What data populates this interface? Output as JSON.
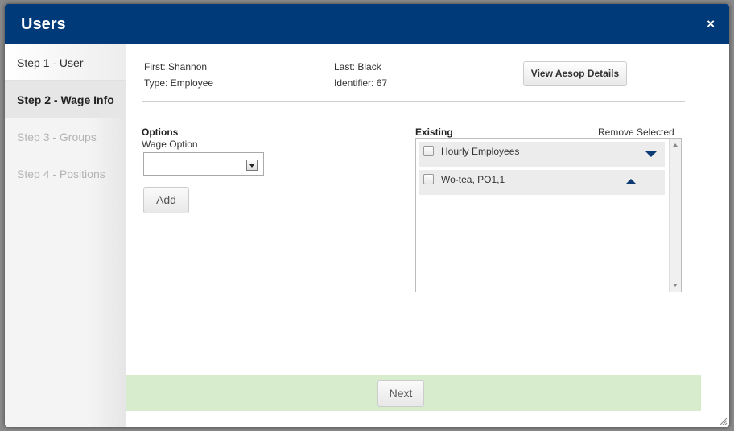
{
  "modal": {
    "title": "Users",
    "close_icon": "close-icon",
    "close_glyph": "×"
  },
  "steps": [
    {
      "label": "Step 1 - User",
      "state": "done"
    },
    {
      "label": "Step 2 - Wage Info",
      "state": "active"
    },
    {
      "label": "Step 3 - Groups",
      "state": "disabled"
    },
    {
      "label": "Step 4 - Positions",
      "state": "disabled"
    }
  ],
  "user_info": {
    "first": "First: Shannon",
    "last": "Last: Black",
    "type": "Type: Employee",
    "identifier": "Identifier: 67",
    "view_details_label": "View Aesop Details"
  },
  "options": {
    "title": "Options",
    "wage_option_label": "Wage Option",
    "wage_option_value": "",
    "add_label": "Add"
  },
  "existing": {
    "title": "Existing",
    "remove_selected_label": "Remove Selected",
    "items": [
      {
        "label": "Hourly Employees",
        "checked": false,
        "arrow": "down"
      },
      {
        "label": "Wo-tea, PO1,1",
        "checked": false,
        "arrow": "up"
      }
    ]
  },
  "footer": {
    "next_label": "Next"
  },
  "colors": {
    "header": "#003a78",
    "footer": "#d7eccd",
    "arrow": "#0d3b74"
  }
}
